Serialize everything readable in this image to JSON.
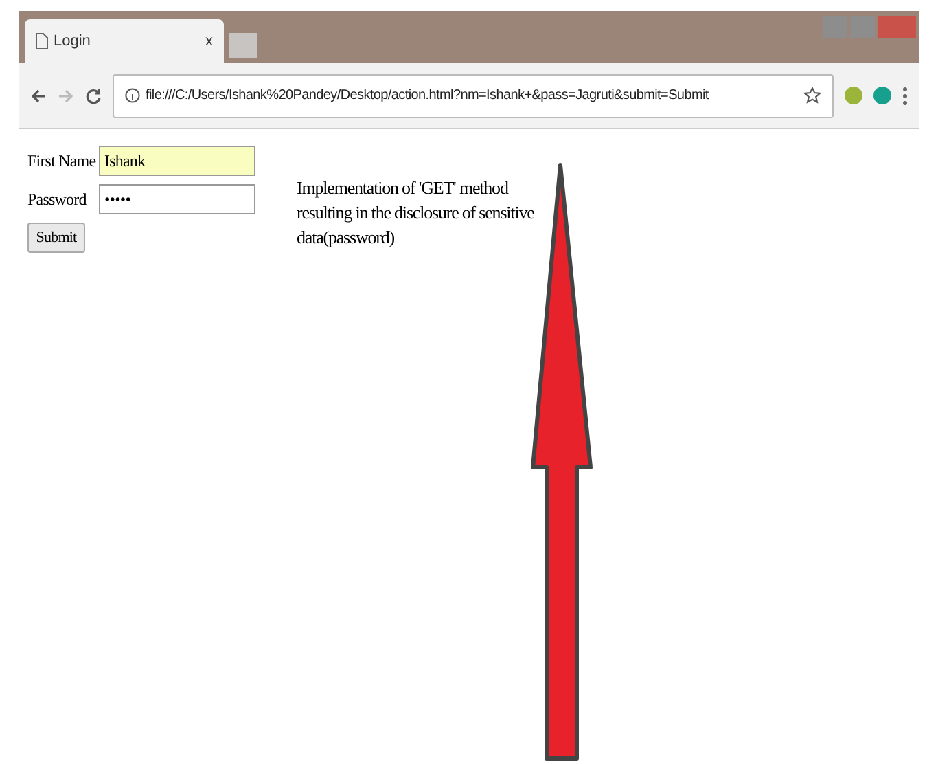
{
  "browser": {
    "tab": {
      "title": "Login",
      "close": "x"
    },
    "address": "file:///C:/Users/Ishank%20Pandey/Desktop/action.html?nm=Ishank+&pass=Jagruti&submit=Submit"
  },
  "form": {
    "first_name": {
      "label": "First Name",
      "value": "Ishank",
      "autofilled": true
    },
    "password": {
      "label": "Password",
      "value": "•••••",
      "autofilled": false
    },
    "submit": "Submit"
  },
  "note": "Implementation of 'GET' method resulting in the disclosure of sensitive data(password)"
}
